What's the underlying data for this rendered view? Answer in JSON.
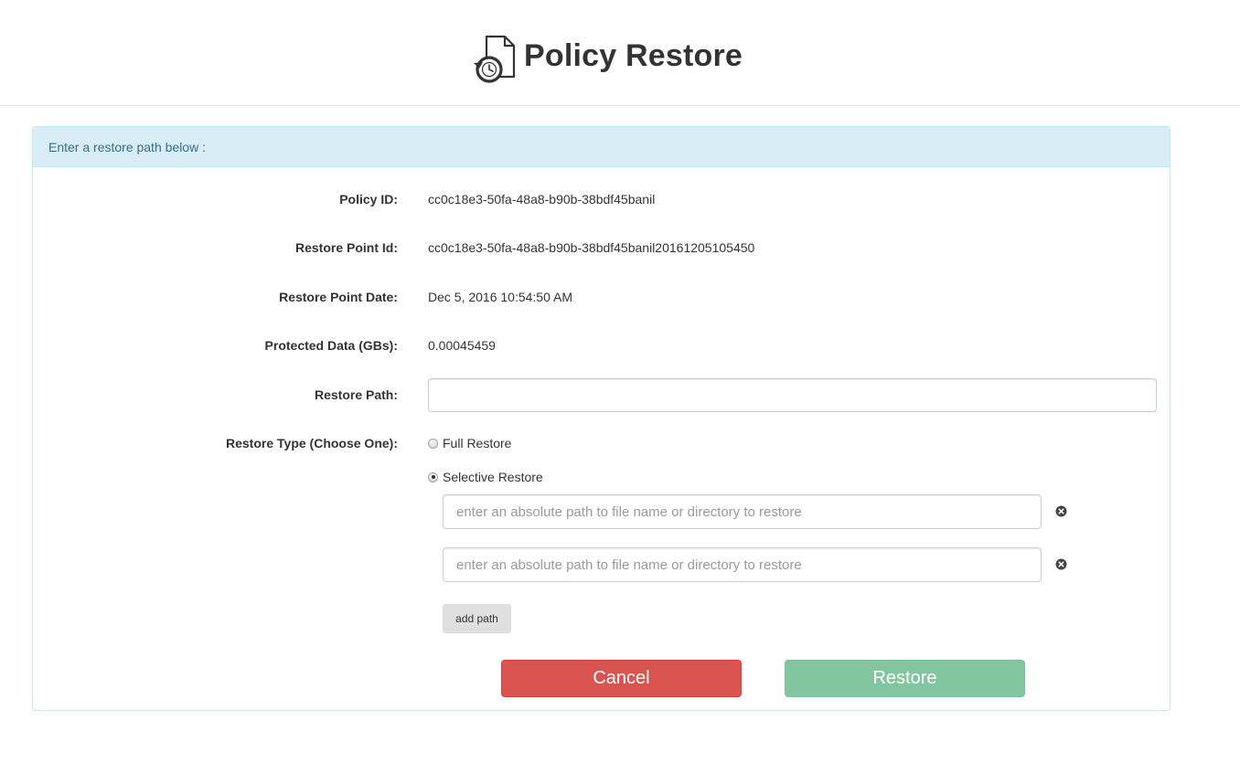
{
  "header": {
    "title": "Policy Restore",
    "icon": "document-restore-icon"
  },
  "panel": {
    "heading": "Enter a restore path below :"
  },
  "fields": {
    "policy_id": {
      "label": "Policy ID:",
      "value": "cc0c18e3-50fa-48a8-b90b-38bdf45banil"
    },
    "restore_point_id": {
      "label": "Restore Point Id:",
      "value": "cc0c18e3-50fa-48a8-b90b-38bdf45banil20161205105450"
    },
    "restore_point_date": {
      "label": "Restore Point Date:",
      "value": "Dec 5, 2016 10:54:50 AM"
    },
    "protected_data": {
      "label": "Protected Data (GBs):",
      "value": "0.00045459"
    },
    "restore_path": {
      "label": "Restore Path:",
      "value": "",
      "placeholder": ""
    },
    "restore_type": {
      "label": "Restore Type (Choose One):",
      "options": [
        {
          "label": "Full Restore",
          "selected": false
        },
        {
          "label": "Selective Restore",
          "selected": true
        }
      ]
    }
  },
  "selective_paths": [
    {
      "value": "",
      "placeholder": "enter an absolute path to file name or directory to restore",
      "remove_icon": "remove-circle-icon"
    },
    {
      "value": "",
      "placeholder": "enter an absolute path to file name or directory to restore",
      "remove_icon": "remove-circle-icon"
    }
  ],
  "buttons": {
    "add_path": "add path",
    "cancel": "Cancel",
    "restore": "Restore"
  },
  "colors": {
    "panel_heading_bg": "#d9edf7",
    "panel_heading_text": "#31708f",
    "panel_border": "#bce8f1",
    "cancel": "#d9534f",
    "restore": "#82c6a0"
  }
}
